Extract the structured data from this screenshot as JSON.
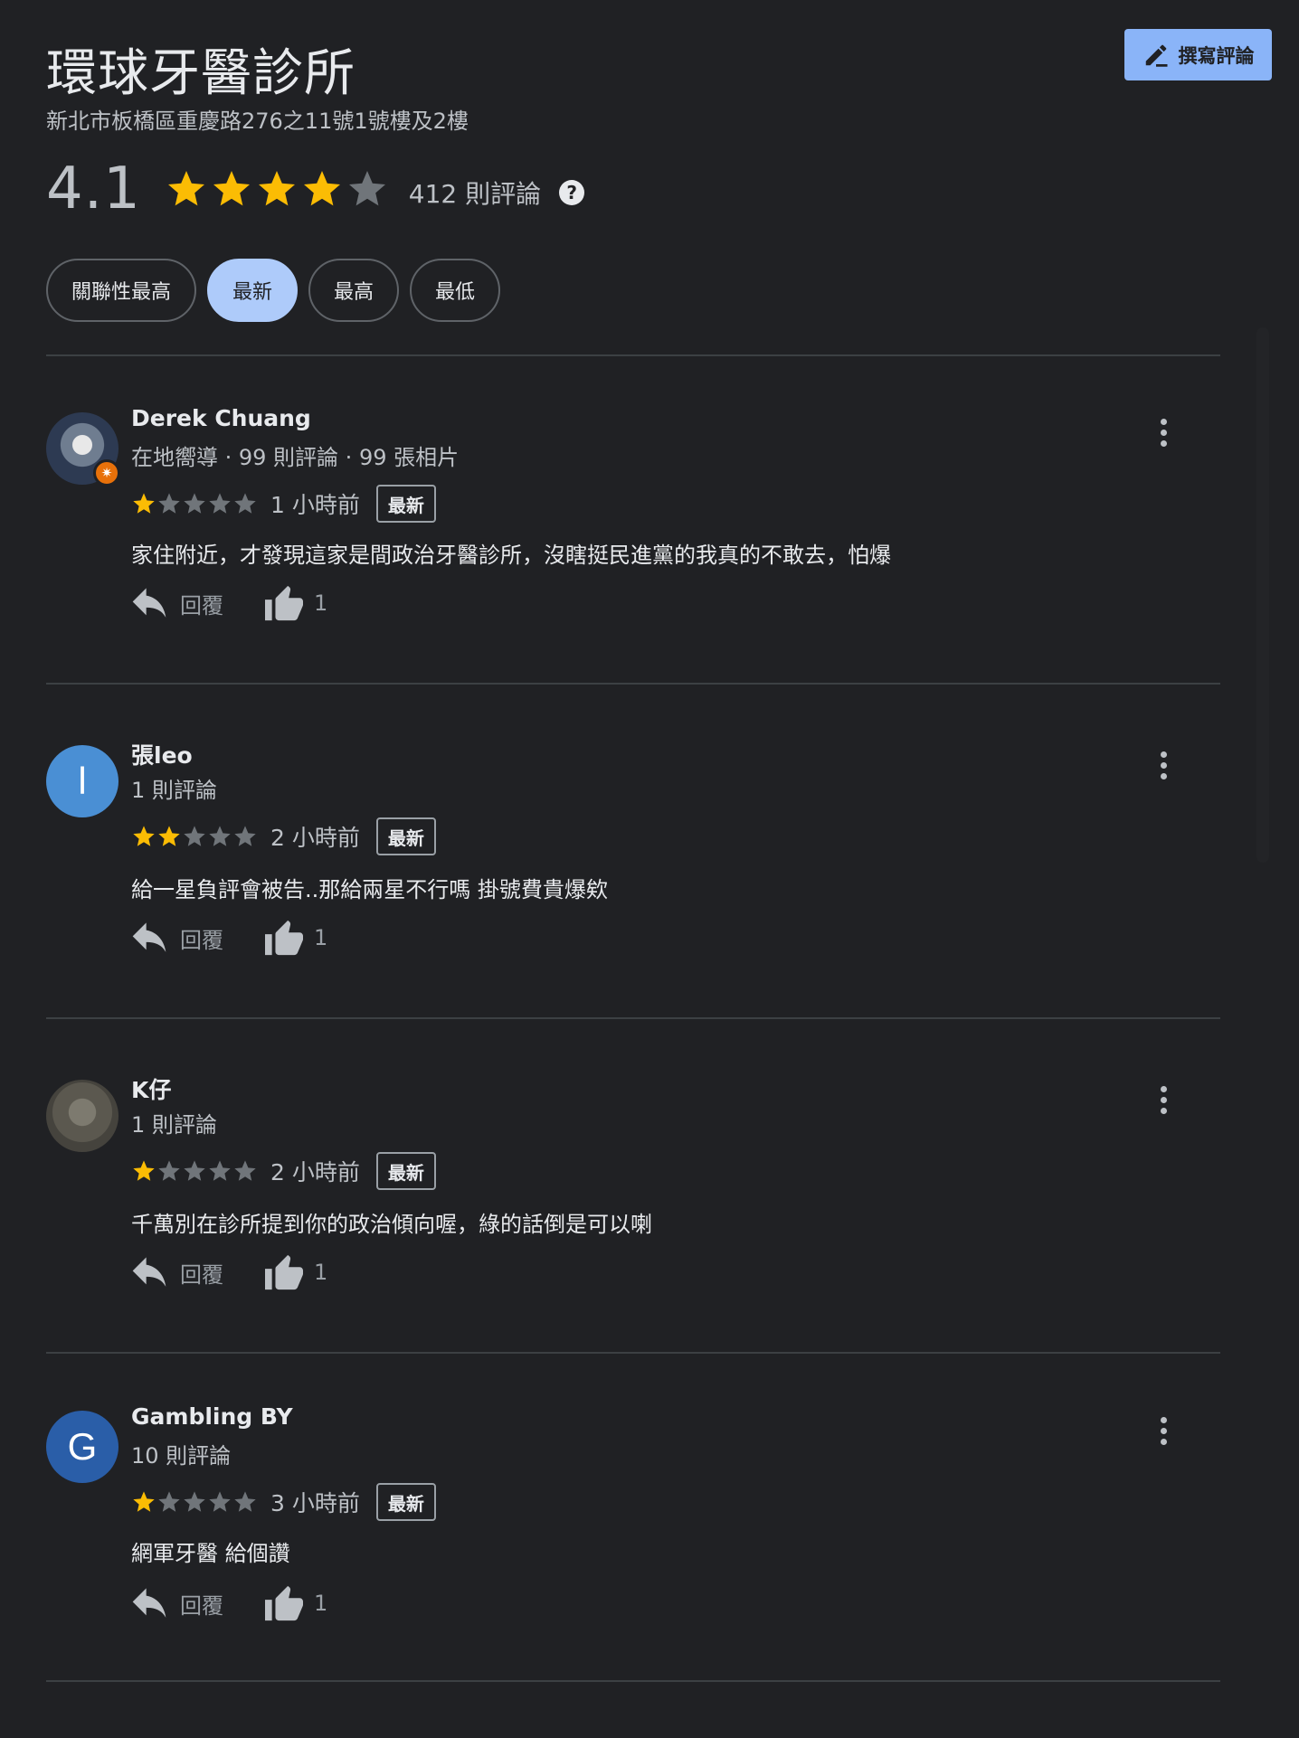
{
  "header": {
    "place_name": "環球牙醫診所",
    "address": "新北市板橋區重慶路276之11號1號樓及2樓",
    "write_review_label": "撰寫評論"
  },
  "summary": {
    "rating": "4.1",
    "rating_value": 4.1,
    "review_count": "412 則評論",
    "help_icon": "?"
  },
  "sort_chips": [
    {
      "label": "關聯性最高",
      "active": false
    },
    {
      "label": "最新",
      "active": true
    },
    {
      "label": "最高",
      "active": false
    },
    {
      "label": "最低",
      "active": false
    }
  ],
  "reviews": [
    {
      "author": "Derek Chuang",
      "avatar_type": "photo",
      "avatar_icon": "local-guide-badge-icon",
      "meta": "在地嚮導 · 99 則評論 · 99 張相片",
      "stars": 1,
      "time": "1 小時前",
      "badge": "最新",
      "text": "家住附近，才發現這家是間政治牙醫診所，沒瞎挺民進黨的我真的不敢去，怕爆",
      "reply_label": "回覆",
      "likes": "1"
    },
    {
      "author": "張leo",
      "avatar_type": "letter",
      "avatar_letter": "l",
      "meta": "1 則評論",
      "stars": 2,
      "time": "2 小時前",
      "badge": "最新",
      "text": "給一星負評會被告..那給兩星不行嗎 掛號費貴爆欸",
      "reply_label": "回覆",
      "likes": "1"
    },
    {
      "author": "K仔",
      "avatar_type": "photo",
      "meta": "1 則評論",
      "stars": 1,
      "time": "2 小時前",
      "badge": "最新",
      "text": "千萬別在診所提到你的政治傾向喔，綠的話倒是可以喇",
      "reply_label": "回覆",
      "likes": "1"
    },
    {
      "author": "Gambling BY",
      "avatar_type": "letter",
      "avatar_letter": "G",
      "meta": "10 則評論",
      "stars": 1,
      "time": "3 小時前",
      "badge": "最新",
      "text": "網軍牙醫 給個讚",
      "reply_label": "回覆",
      "likes": "1"
    }
  ],
  "colors": {
    "background": "#202124",
    "accent": "#8ab4f8",
    "active_chip": "#aecbfa",
    "star_filled": "#fbbc04",
    "star_empty": "#70757a",
    "divider": "#3c4043"
  }
}
